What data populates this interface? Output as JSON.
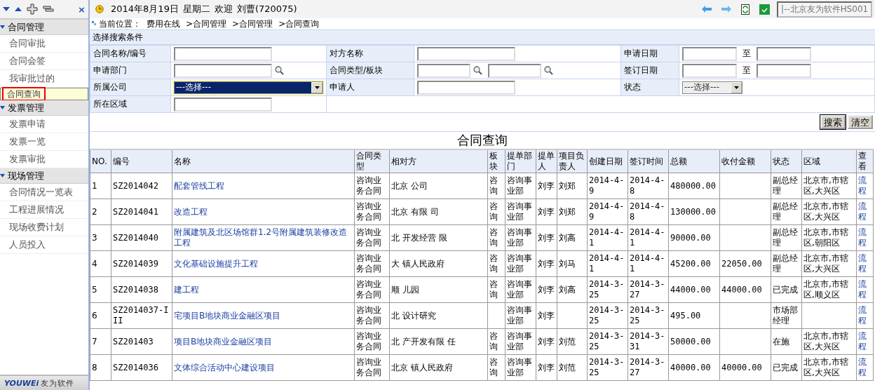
{
  "sidebar": {
    "close": "×",
    "groups": [
      {
        "label": "合同管理",
        "expanded": true,
        "items": [
          {
            "label": "合同审批",
            "selected": false
          },
          {
            "label": "合同会签",
            "selected": false
          },
          {
            "label": "我审批过的",
            "selected": false
          },
          {
            "label": "合同查询",
            "selected": true
          }
        ]
      },
      {
        "label": "发票管理",
        "expanded": true,
        "items": [
          {
            "label": "发票申请",
            "selected": false
          },
          {
            "label": "发票一览",
            "selected": false
          },
          {
            "label": "发票审批",
            "selected": false
          }
        ]
      },
      {
        "label": "现场管理",
        "expanded": true,
        "items": [
          {
            "label": "合同情况一览表",
            "selected": false
          },
          {
            "label": "工程进展情况",
            "selected": false
          },
          {
            "label": "现场收费计划",
            "selected": false
          },
          {
            "label": "人员投入",
            "selected": false
          }
        ]
      }
    ],
    "logo": {
      "brand": "YOUWEi",
      "name": "友为软件"
    }
  },
  "header": {
    "date": "2014年8月19日",
    "weekday": "星期二",
    "welcome": "欢迎",
    "user": "刘曹(720075)",
    "company": "|--北京友为软件HS001"
  },
  "breadcrumb": {
    "label": "当前位置：",
    "path": [
      "费用在线",
      ">合同管理",
      ">合同管理",
      ">合同查询"
    ]
  },
  "search": {
    "title": "选择搜索条件",
    "rows": [
      [
        {
          "label": "合同名称/编号",
          "kind": "text"
        },
        {
          "label": "对方名称",
          "kind": "text"
        },
        {
          "label": "申请日期",
          "kind": "range",
          "separator": "至"
        }
      ],
      [
        {
          "label": "申请部门",
          "kind": "lookup"
        },
        {
          "label": "合同类型/板块",
          "kind": "double_lookup"
        },
        {
          "label": "签订日期",
          "kind": "range",
          "separator": "至"
        }
      ],
      [
        {
          "label": "所属公司",
          "kind": "select",
          "value": "---选择---",
          "focused": true
        },
        {
          "label": "申请人",
          "kind": "text"
        },
        {
          "label": "状态",
          "kind": "select",
          "value": "---选择---",
          "focused": false
        }
      ],
      [
        {
          "label": "所在区域",
          "kind": "text"
        }
      ]
    ],
    "buttons": [
      {
        "label": "搜索",
        "default": true
      },
      {
        "label": "清空",
        "default": false
      }
    ]
  },
  "table": {
    "title": "合同查询",
    "columns": [
      {
        "label": "NO.",
        "kind": "text"
      },
      {
        "label": "编号",
        "kind": "mono"
      },
      {
        "label": "名称",
        "kind": "link"
      },
      {
        "label": "合同类型",
        "kind": "text"
      },
      {
        "label": "相对方",
        "kind": "text"
      },
      {
        "label": "板块",
        "kind": "text"
      },
      {
        "label": "提单部门",
        "kind": "text"
      },
      {
        "label": "提单人",
        "kind": "text"
      },
      {
        "label": "项目负责人",
        "kind": "text"
      },
      {
        "label": "创建日期",
        "kind": "mono"
      },
      {
        "label": "签订时间",
        "kind": "mono"
      },
      {
        "label": "总额",
        "kind": "mono"
      },
      {
        "label": "收付金额",
        "kind": "mono"
      },
      {
        "label": "状态",
        "kind": "text"
      },
      {
        "label": "区域",
        "kind": "text"
      },
      {
        "label": "查看",
        "kind": "link"
      }
    ],
    "rows": [
      [
        "1",
        "SZ2014042",
        "配套管线工程",
        "咨询业务合同",
        "北京 公司",
        "咨询",
        "咨询事业部",
        "刘李",
        "刘郑",
        "2014-4-9",
        "2014-4-8",
        "480000.00",
        "",
        "副总经理",
        "北京市,市辖区,大兴区",
        "流程"
      ],
      [
        "2",
        "SZ2014041",
        "改造工程",
        "咨询业务合同",
        "北京 有限 司",
        "咨询",
        "咨询事业部",
        "刘李",
        "刘郑",
        "2014-4-9",
        "2014-4-8",
        "130000.00",
        "",
        "副总经理",
        "北京市,市辖区,大兴区",
        "流程"
      ],
      [
        "3",
        "SZ2014040",
        "附属建筑及北区场馆群1.2号附属建筑装修改造工程",
        "咨询业务合同",
        "北 开发经营 限",
        "咨询",
        "咨询事业部",
        "刘李",
        "刘高",
        "2014-4-1",
        "2014-4-1",
        "90000.00",
        "",
        "副总经理",
        "北京市,市辖区,朝阳区",
        "流程"
      ],
      [
        "4",
        "SZ2014039",
        "文化基础设施提升工程",
        "咨询业务合同",
        "大 镇人民政府",
        "咨询",
        "咨询事业部",
        "刘李",
        "刘马",
        "2014-4-1",
        "2014-4-1",
        "45200.00",
        "22050.00",
        "副总经理",
        "北京市,市辖区,大兴区",
        "流程"
      ],
      [
        "5",
        "SZ2014038",
        "建工程",
        "咨询业务合同",
        "顺 儿园",
        "咨询",
        "咨询事业部",
        "刘李",
        "刘高",
        "2014-3-25",
        "2014-3-27",
        "44000.00",
        "44000.00",
        "已完成",
        "北京市,市辖区,顺义区",
        "流程"
      ],
      [
        "6",
        "SZ2014037-III",
        "宅项目B地块商业金融区项目",
        "咨询业务合同",
        "北 设计研究",
        "",
        "咨询事业部",
        "刘李",
        "",
        "2014-3-25",
        "2014-3-25",
        "495.00",
        "",
        "市场部经理",
        "",
        "流程"
      ],
      [
        "7",
        "SZ201403",
        "项目B地块商业金融区项目",
        "咨询业务合同",
        "北 产开发有限 任",
        "咨询",
        "咨询事业部",
        "刘李",
        "刘范",
        "2014-3-25",
        "2014-3-31",
        "50000.00",
        "",
        "在施",
        "北京市,市辖区,大兴区",
        "流程"
      ],
      [
        "8",
        "SZ2014036",
        "文体综合活动中心建设项目",
        "咨询业务合同",
        "北京 镇人民政府",
        "咨询",
        "咨询事业部",
        "刘李",
        "刘范",
        "2014-3-25",
        "2014-3-27",
        "40000.00",
        "40000.00",
        "已完成",
        "北京市,市辖区,大兴区",
        "流程"
      ]
    ]
  }
}
